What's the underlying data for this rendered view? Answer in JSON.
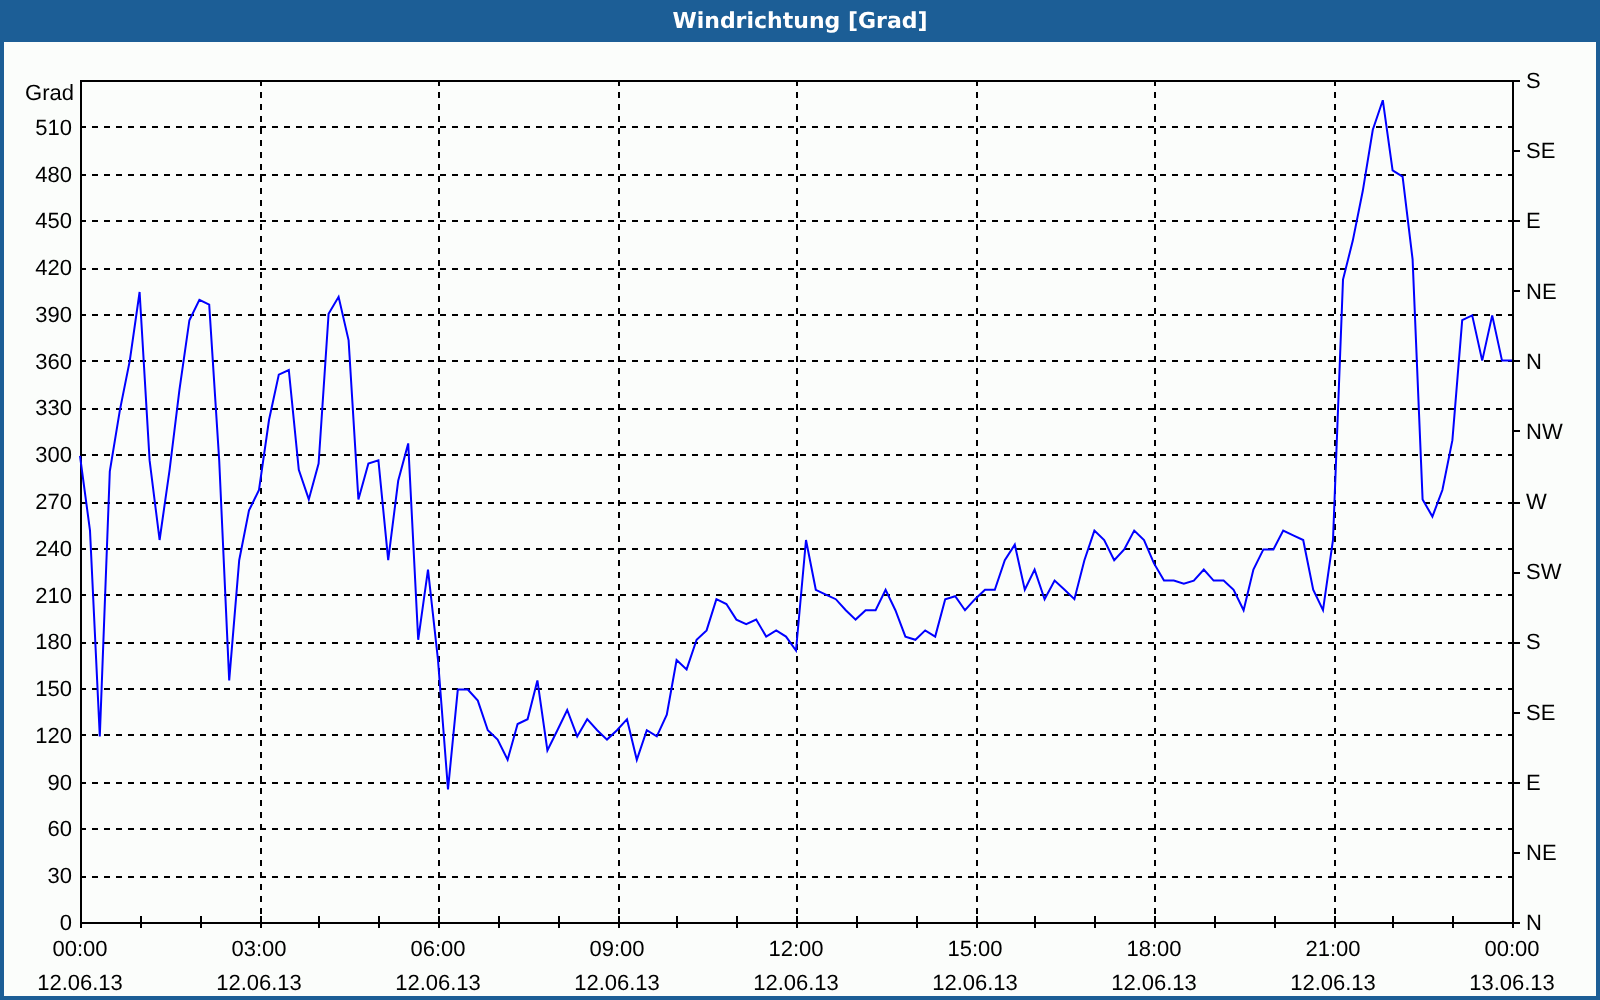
{
  "window": {
    "title": "Windrichtung [Grad]"
  },
  "chart": {
    "chart_data": {
      "type": "line",
      "grid": true,
      "ylabel": "Grad",
      "ylim": [
        0,
        540
      ],
      "yticks": [
        0,
        30,
        60,
        90,
        120,
        150,
        180,
        210,
        240,
        270,
        300,
        330,
        360,
        390,
        420,
        450,
        480,
        510
      ],
      "categories": [
        "00:00\n12.06.13",
        null,
        null,
        null,
        null,
        null,
        null,
        null,
        null,
        null,
        null,
        null,
        null,
        null,
        null,
        null,
        null,
        null,
        "03:00\n12.06.13",
        null,
        null,
        null,
        null,
        null,
        null,
        null,
        null,
        null,
        null,
        null,
        null,
        null,
        null,
        null,
        null,
        null,
        "06:00\n12.06.13",
        null,
        null,
        null,
        null,
        null,
        null,
        null,
        null,
        null,
        null,
        null,
        null,
        null,
        null,
        null,
        null,
        null,
        "09:00\n12.06.13",
        null,
        null,
        null,
        null,
        null,
        null,
        null,
        null,
        null,
        null,
        null,
        null,
        null,
        null,
        null,
        null,
        null,
        "12:00\n12.06.13",
        null,
        null,
        null,
        null,
        null,
        null,
        null,
        null,
        null,
        null,
        null,
        null,
        null,
        null,
        null,
        null,
        null,
        "15:00\n12.06.13",
        null,
        null,
        null,
        null,
        null,
        null,
        null,
        null,
        null,
        null,
        null,
        null,
        null,
        null,
        null,
        null,
        null,
        "18:00\n12.06.13",
        null,
        null,
        null,
        null,
        null,
        null,
        null,
        null,
        null,
        null,
        null,
        null,
        null,
        null,
        null,
        null,
        null,
        "21:00\n12.06.13",
        null,
        null,
        null,
        null,
        null,
        null,
        null,
        null,
        null,
        null,
        null,
        null,
        null,
        null,
        null,
        null,
        null,
        "00:00\n13.06.13"
      ],
      "series": [
        {
          "color": "#0000ff",
          "values": [
            299,
            251,
            119,
            289,
            328,
            360,
            404,
            296,
            245,
            290,
            341,
            386,
            399,
            396,
            296,
            155,
            232,
            264,
            277,
            322,
            351,
            354,
            290,
            271,
            294,
            390,
            401,
            373,
            271,
            294,
            296,
            232,
            283,
            307,
            181,
            226,
            168,
            85,
            149,
            149,
            142,
            123,
            117,
            104,
            127,
            130,
            155,
            110,
            123,
            136,
            119,
            130,
            123,
            117,
            123,
            130,
            104,
            123,
            119,
            133,
            168,
            162,
            181,
            187,
            207,
            204,
            194,
            191,
            194,
            183,
            187,
            183,
            174,
            245,
            213,
            210,
            207,
            200,
            194,
            200,
            200,
            213,
            200,
            183,
            181,
            187,
            183,
            207,
            209,
            200,
            207,
            213,
            213,
            232,
            242,
            213,
            226,
            207,
            219,
            213,
            207,
            232,
            251,
            245,
            232,
            239,
            251,
            245,
            230,
            219,
            219,
            217,
            219,
            226,
            219,
            219,
            213,
            200,
            226,
            239,
            239,
            251,
            248,
            245,
            213,
            200,
            245,
            412,
            437,
            469,
            508,
            527,
            482,
            478,
            425,
            271,
            260,
            277,
            309,
            386,
            389,
            360,
            389,
            360,
            360
          ]
        }
      ]
    },
    "compass_ticks": [
      "S",
      "SE",
      "E",
      "NE",
      "N",
      "NW",
      "W",
      "SW",
      "S",
      "SE",
      "E",
      "NE",
      "N"
    ]
  }
}
